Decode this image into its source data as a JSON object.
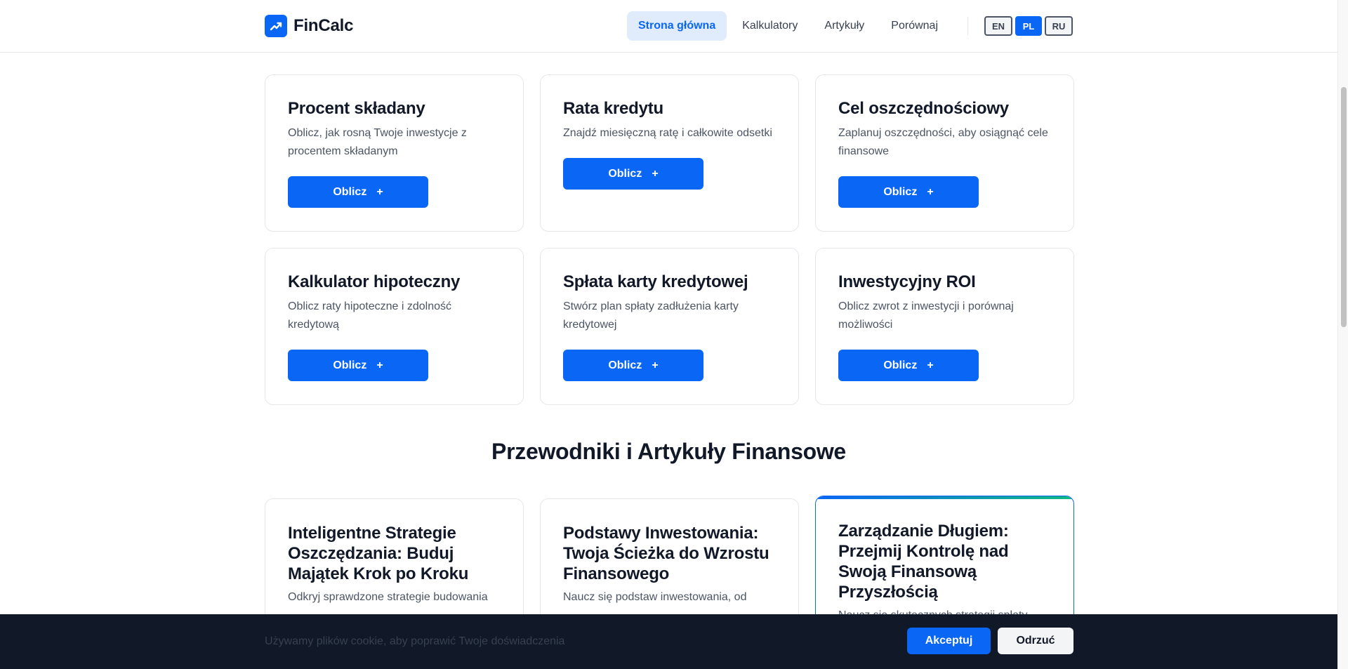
{
  "brand": {
    "name": "FinCalc",
    "logo_icon": "trending-up-icon",
    "accent_color": "#0a66f5"
  },
  "nav": {
    "items": [
      {
        "label": "Strona główna",
        "active": true
      },
      {
        "label": "Kalkulatory",
        "active": false
      },
      {
        "label": "Artykuły",
        "active": false
      },
      {
        "label": "Porównaj",
        "active": false
      }
    ]
  },
  "languages": [
    {
      "code": "EN",
      "active": false
    },
    {
      "code": "PL",
      "active": true
    },
    {
      "code": "RU",
      "active": false
    }
  ],
  "calculators": [
    {
      "title": "Procent składany",
      "description": "Oblicz, jak rosną Twoje inwestycje z procentem składanym",
      "button": "Oblicz",
      "button_icon": "+"
    },
    {
      "title": "Rata kredytu",
      "description": "Znajdź miesięczną ratę i całkowite odsetki",
      "button": "Oblicz",
      "button_icon": "+"
    },
    {
      "title": "Cel oszczędnościowy",
      "description": "Zaplanuj oszczędności, aby osiągnąć cele finansowe",
      "button": "Oblicz",
      "button_icon": "+"
    },
    {
      "title": "Kalkulator hipoteczny",
      "description": "Oblicz raty hipoteczne i zdolność kredytową",
      "button": "Oblicz",
      "button_icon": "+"
    },
    {
      "title": "Spłata karty kredytowej",
      "description": "Stwórz plan spłaty zadłużenia karty kredytowej",
      "button": "Oblicz",
      "button_icon": "+"
    },
    {
      "title": "Inwestycyjny ROI",
      "description": "Oblicz zwrot z inwestycji i porównaj możliwości",
      "button": "Oblicz",
      "button_icon": "+"
    }
  ],
  "articles_section": {
    "title": "Przewodniki i Artykuły Finansowe",
    "items": [
      {
        "title": "Inteligentne Strategie Oszczędzania: Buduj Majątek Krok po Kroku",
        "description": "Odkryj sprawdzone strategie budowania"
      },
      {
        "title": "Podstawy Inwestowania: Twoja Ścieżka do Wzrostu Finansowego",
        "description": "Naucz się podstaw inwestowania, od"
      },
      {
        "title": "Zarządzanie Długiem: Przejmij Kontrolę nad Swoją Finansową Przyszłością",
        "description": "Naucz się skutecznych strategii spłaty",
        "highlighted": true
      }
    ]
  },
  "cookie_banner": {
    "text": "Używamy plików cookie, aby poprawić Twoje doświadczenia",
    "accept_label": "Akceptuj",
    "reject_label": "Odrzuć"
  }
}
